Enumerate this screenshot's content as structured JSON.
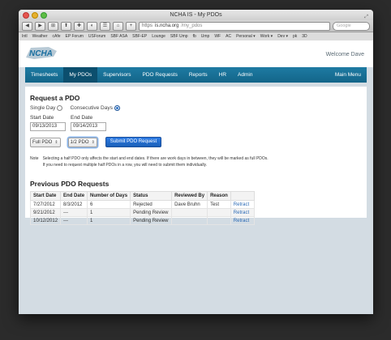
{
  "window": {
    "title": "NCHA IS - My PDOs"
  },
  "toolbar": {
    "buttons": [
      "◀",
      "▶",
      "⊞",
      "⬆",
      "✚",
      "◐",
      "☰",
      "⌂",
      "+"
    ],
    "url_secure": "https",
    "url_domain": "is.ncha.org",
    "url_path": "/my_pdos",
    "search_placeholder": "Google"
  },
  "bookmarks": [
    "Intl",
    "Weather",
    "cAfe",
    "EP Forum",
    "USForum",
    "SBF ASA",
    "SBF-EP",
    "Lounge",
    "SBF Ump",
    "fb",
    "Ump",
    "WF",
    "AC",
    "Personal ▾",
    "Work ▾",
    "Dev ▾",
    "pk",
    "3D"
  ],
  "header": {
    "logo_text": "NCHA",
    "welcome": "Welcome Dave"
  },
  "nav": {
    "items": [
      "Timesheets",
      "My PDOs",
      "Supervisors",
      "PDO Requests",
      "Reports",
      "HR",
      "Admin"
    ],
    "main_menu": "Main Menu"
  },
  "request": {
    "title": "Request a PDO",
    "single_day": "Single Day",
    "consecutive": "Consecutive Days",
    "start_label": "Start Date",
    "end_label": "End Date",
    "start_value": "09/13/2013",
    "end_value": "09/14/2013",
    "start_type": "Full PDO",
    "end_type": "1/2 PDO",
    "submit": "Submit PDO Request",
    "note_label": "Note",
    "note_line1": "Selecting a half PDO only affects the start and end dates. If there are work days in between, they will be marked as full PDOs.",
    "note_line2": "If you need to request multiple half PDOs in a row, you will need to submit them individually."
  },
  "previous": {
    "title": "Previous PDO Requests",
    "columns": [
      "Start Date",
      "End Date",
      "Number of Days",
      "Status",
      "Reviewed By",
      "Reason",
      ""
    ],
    "rows": [
      [
        "7/27/2012",
        "8/3/2012",
        "6",
        "Rejected",
        "Dave Bruhn",
        "Test",
        "Retract"
      ],
      [
        "9/21/2012",
        "---",
        "1",
        "Pending Review",
        "",
        "",
        "Retract"
      ],
      [
        "10/12/2012",
        "---",
        "1",
        "Pending Review",
        "",
        "",
        "Retract"
      ]
    ]
  }
}
